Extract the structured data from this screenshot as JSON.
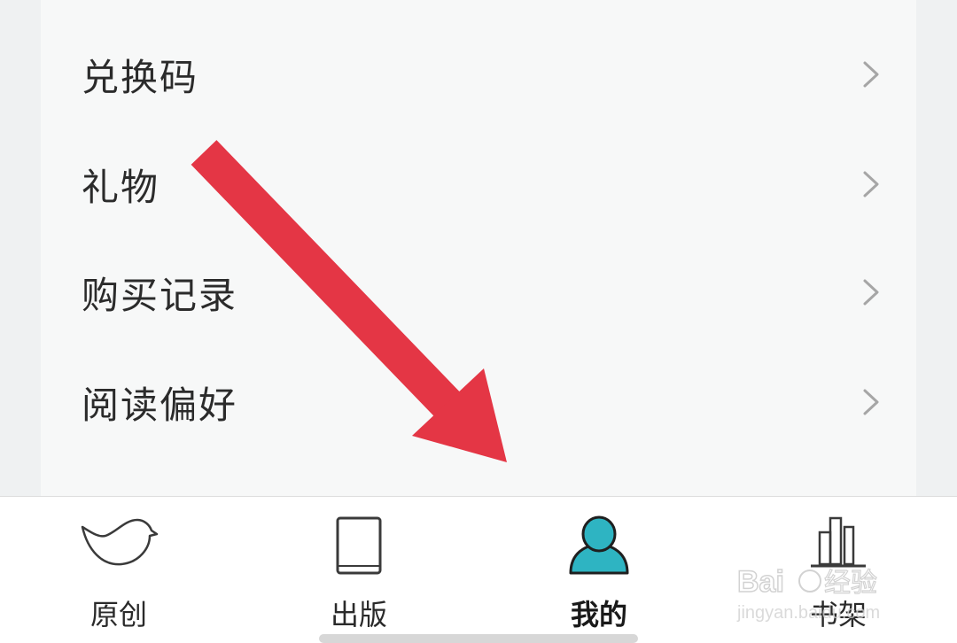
{
  "menu": {
    "items": [
      {
        "label": "兑换码"
      },
      {
        "label": "礼物"
      },
      {
        "label": "购买记录"
      },
      {
        "label": "阅读偏好"
      }
    ]
  },
  "tabbar": {
    "tabs": [
      {
        "label": "原创",
        "icon": "bird-icon"
      },
      {
        "label": "出版",
        "icon": "book-icon"
      },
      {
        "label": "我的",
        "icon": "user-icon"
      },
      {
        "label": "书架",
        "icon": "bookshelf-icon"
      }
    ],
    "active_index": 2
  },
  "watermark": {
    "text": "Baidu经验",
    "subtext": "jingyan.baidu.com"
  },
  "colors": {
    "accent": "#2eb4c2",
    "arrow": "#e43645",
    "chevron": "#a6a6a6",
    "text": "#2b2b2b"
  }
}
